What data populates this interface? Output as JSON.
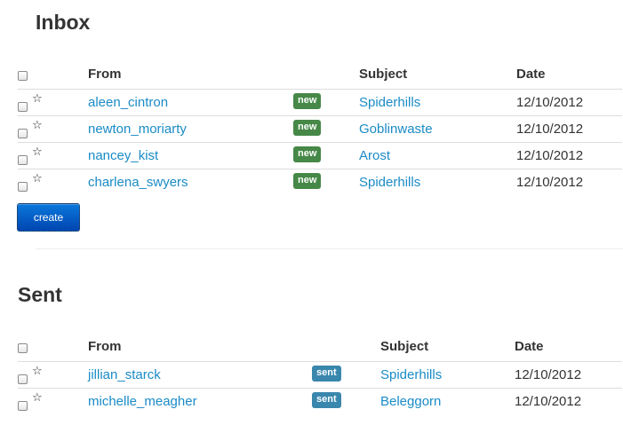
{
  "inbox": {
    "title": "Inbox",
    "columns": {
      "from": "From",
      "subject": "Subject",
      "date": "Date"
    },
    "rows": [
      {
        "from": "aleen_cintron",
        "badge": "new",
        "subject": "Spiderhills",
        "date": "12/10/2012"
      },
      {
        "from": "newton_moriarty",
        "badge": "new",
        "subject": "Goblinwaste",
        "date": "12/10/2012"
      },
      {
        "from": "nancey_kist",
        "badge": "new",
        "subject": "Arost",
        "date": "12/10/2012"
      },
      {
        "from": "charlena_swyers",
        "badge": "new",
        "subject": "Spiderhills",
        "date": "12/10/2012"
      }
    ],
    "create_label": "create"
  },
  "sent": {
    "title": "Sent",
    "columns": {
      "from": "From",
      "subject": "Subject",
      "date": "Date"
    },
    "rows": [
      {
        "from": "jillian_starck",
        "badge": "sent",
        "subject": "Spiderhills",
        "date": "12/10/2012"
      },
      {
        "from": "michelle_meagher",
        "badge": "sent",
        "subject": "Beleggorn",
        "date": "12/10/2012"
      }
    ]
  },
  "icons": {
    "checkbox": "checkbox-icon",
    "star": "star-icon"
  },
  "colors": {
    "link": "#1a8bc6",
    "badge_new": "#468847",
    "badge_sent": "#3a87ad",
    "button": "#0a63d1"
  }
}
